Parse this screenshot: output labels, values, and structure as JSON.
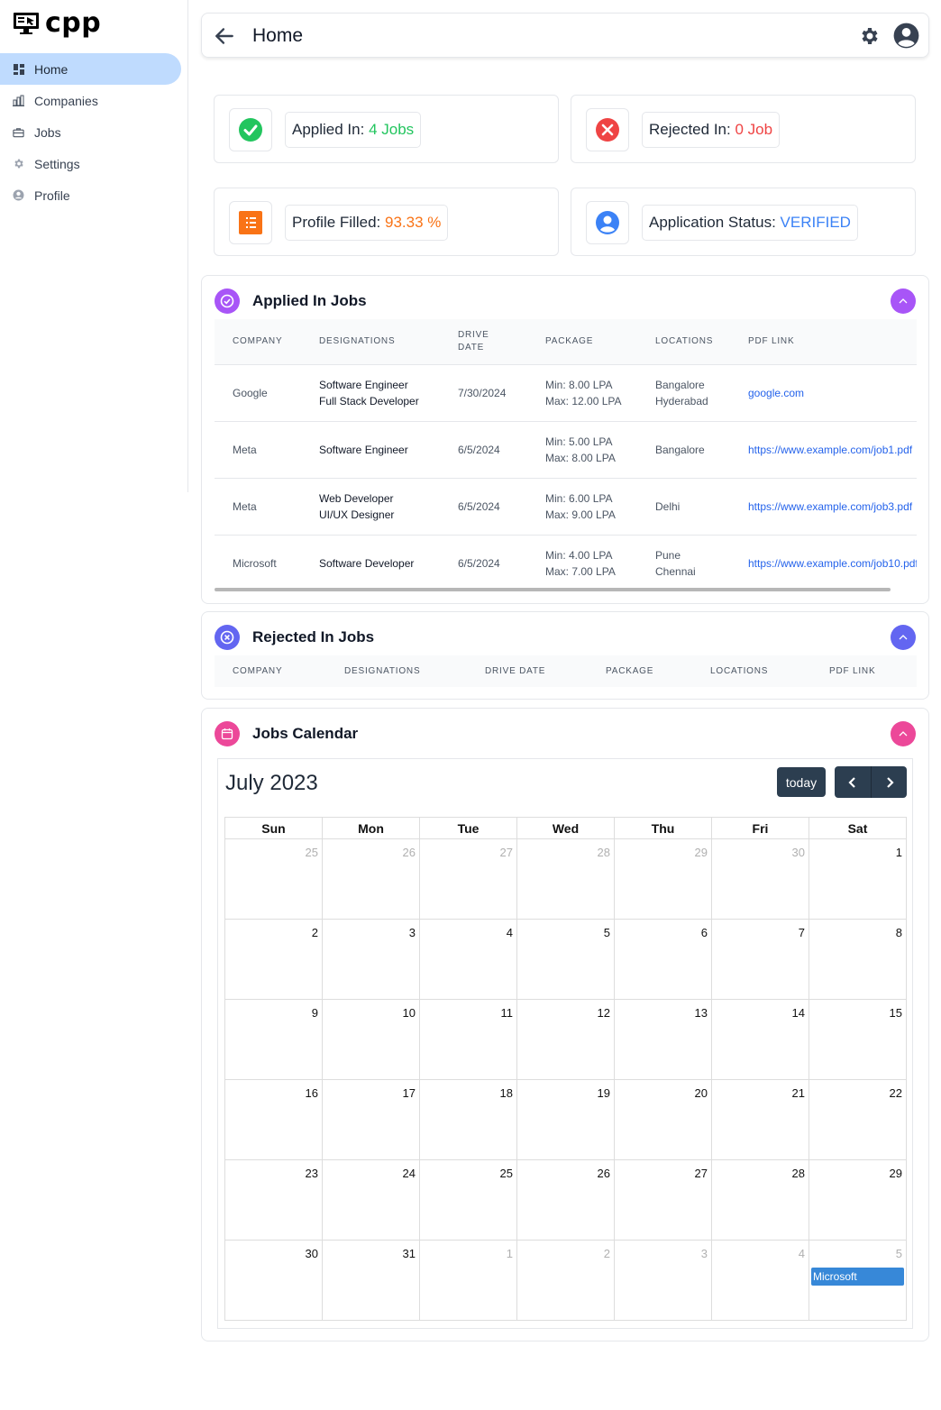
{
  "brand": {
    "name": "cpp"
  },
  "sidebar": {
    "items": [
      {
        "label": "Home",
        "icon": "dashboard-icon",
        "active": true
      },
      {
        "label": "Companies",
        "icon": "building-icon"
      },
      {
        "label": "Jobs",
        "icon": "briefcase-icon"
      },
      {
        "label": "Settings",
        "icon": "gear-icon"
      },
      {
        "label": "Profile",
        "icon": "user-icon"
      }
    ]
  },
  "header": {
    "title": "Home"
  },
  "stats": {
    "applied": {
      "label": "Applied In:",
      "value": "4 Jobs",
      "color": "#22c55e"
    },
    "rejected": {
      "label": "Rejected In:",
      "value": "0 Job",
      "color": "#ef4444"
    },
    "profile": {
      "label": "Profile Filled:",
      "value": "93.33 %",
      "color": "#f97316"
    },
    "status": {
      "label": "Application Status:",
      "value": "VERIFIED",
      "color": "#3b82f6"
    }
  },
  "applied_jobs": {
    "title": "Applied In Jobs",
    "columns": [
      "COMPANY",
      "DESIGNATIONS",
      "DRIVE\nDATE",
      "PACKAGE",
      "LOCATIONS",
      "PDF LINK"
    ],
    "rows": [
      {
        "company": "Google",
        "designations": [
          "Software Engineer",
          "Full Stack Developer"
        ],
        "date": "7/30/2024",
        "package": [
          "Min: 8.00 LPA",
          "Max: 12.00 LPA"
        ],
        "locations": [
          "Bangalore",
          "Hyderabad"
        ],
        "link": "google.com"
      },
      {
        "company": "Meta",
        "designations": [
          "Software Engineer"
        ],
        "date": "6/5/2024",
        "package": [
          "Min: 5.00 LPA",
          "Max: 8.00 LPA"
        ],
        "locations": [
          "Bangalore"
        ],
        "link": "https://www.example.com/job1.pdf"
      },
      {
        "company": "Meta",
        "designations": [
          "Web Developer",
          "UI/UX Designer"
        ],
        "date": "6/5/2024",
        "package": [
          "Min: 6.00 LPA",
          "Max: 9.00 LPA"
        ],
        "locations": [
          "Delhi"
        ],
        "link": "https://www.example.com/job3.pdf"
      },
      {
        "company": "Microsoft",
        "designations": [
          "Software Developer"
        ],
        "date": "6/5/2024",
        "package": [
          "Min: 4.00 LPA",
          "Max: 7.00 LPA"
        ],
        "locations": [
          "Pune",
          "Chennai"
        ],
        "link": "https://www.example.com/job10.pdf"
      }
    ]
  },
  "rejected_jobs": {
    "title": "Rejected In Jobs",
    "columns": [
      "COMPANY",
      "DESIGNATIONS",
      "DRIVE DATE",
      "PACKAGE",
      "LOCATIONS",
      "PDF LINK"
    ]
  },
  "calendar": {
    "title": "Jobs Calendar",
    "month_label": "July 2023",
    "today_label": "today",
    "weekdays": [
      "Sun",
      "Mon",
      "Tue",
      "Wed",
      "Thu",
      "Fri",
      "Sat"
    ],
    "weeks": [
      [
        {
          "d": "25",
          "o": true
        },
        {
          "d": "26",
          "o": true
        },
        {
          "d": "27",
          "o": true
        },
        {
          "d": "28",
          "o": true
        },
        {
          "d": "29",
          "o": true
        },
        {
          "d": "30",
          "o": true
        },
        {
          "d": "1"
        }
      ],
      [
        {
          "d": "2"
        },
        {
          "d": "3"
        },
        {
          "d": "4"
        },
        {
          "d": "5"
        },
        {
          "d": "6"
        },
        {
          "d": "7"
        },
        {
          "d": "8"
        }
      ],
      [
        {
          "d": "9"
        },
        {
          "d": "10"
        },
        {
          "d": "11"
        },
        {
          "d": "12"
        },
        {
          "d": "13"
        },
        {
          "d": "14"
        },
        {
          "d": "15"
        }
      ],
      [
        {
          "d": "16"
        },
        {
          "d": "17"
        },
        {
          "d": "18"
        },
        {
          "d": "19"
        },
        {
          "d": "20"
        },
        {
          "d": "21"
        },
        {
          "d": "22"
        }
      ],
      [
        {
          "d": "23"
        },
        {
          "d": "24"
        },
        {
          "d": "25"
        },
        {
          "d": "26"
        },
        {
          "d": "27"
        },
        {
          "d": "28"
        },
        {
          "d": "29"
        }
      ],
      [
        {
          "d": "30"
        },
        {
          "d": "31"
        },
        {
          "d": "1",
          "o": true
        },
        {
          "d": "2",
          "o": true
        },
        {
          "d": "3",
          "o": true
        },
        {
          "d": "4",
          "o": true
        },
        {
          "d": "5",
          "o": true,
          "event": "Microsoft"
        }
      ]
    ]
  },
  "colors": {
    "accent_purple": "#a855f7",
    "accent_indigo": "#6366f1",
    "accent_pink": "#ec4899",
    "calendar_button": "#2c3e50",
    "event": "#3788d8",
    "nav_active": "#bfdbfe"
  }
}
